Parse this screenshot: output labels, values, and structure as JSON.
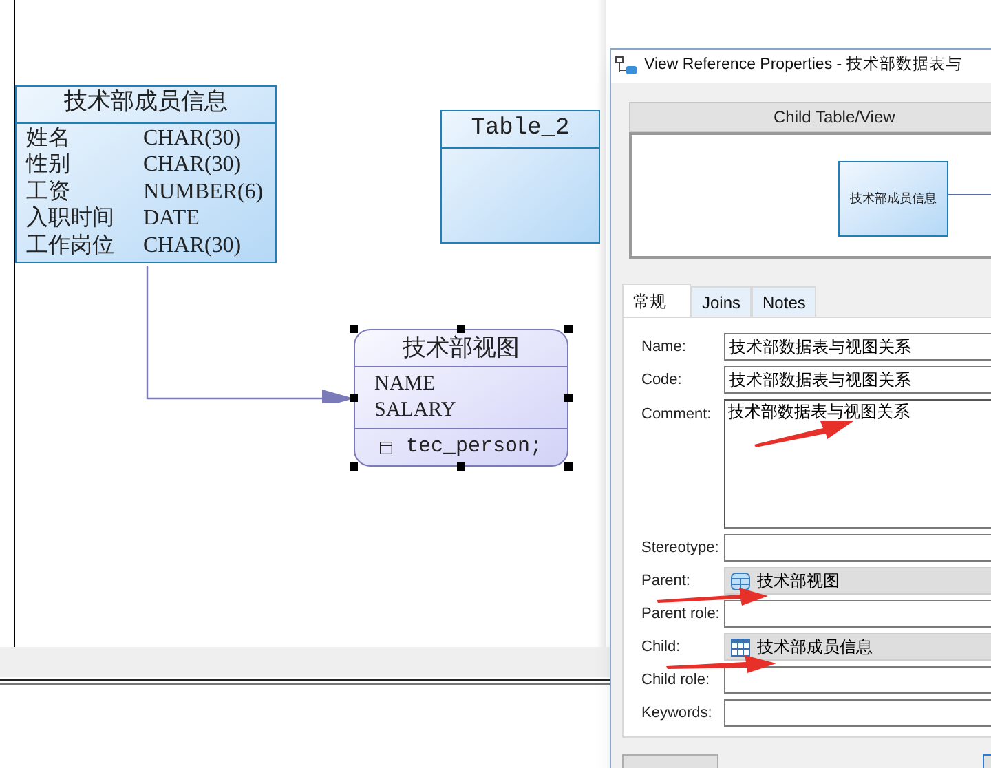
{
  "canvas": {
    "entities": [
      {
        "kind": "table",
        "title": "技术部成员信息",
        "selected": false,
        "columns": [
          {
            "name": "姓名",
            "type": "CHAR(30)"
          },
          {
            "name": "性别",
            "type": "CHAR(30)"
          },
          {
            "name": "工资",
            "type": "NUMBER(6)"
          },
          {
            "name": "入职时间",
            "type": "DATE"
          },
          {
            "name": "工作岗位",
            "type": "CHAR(30)"
          }
        ]
      },
      {
        "kind": "table",
        "title": "Table_2",
        "selected": false
      },
      {
        "kind": "view",
        "title": "技术部视图",
        "selected": true,
        "columns": [
          {
            "name": "NAME"
          },
          {
            "name": "SALARY"
          }
        ],
        "query": "tec_person;"
      }
    ]
  },
  "dialog": {
    "title": "View Reference Properties - 技术部数据表与",
    "preview": {
      "header": "Child Table/View",
      "node": "技术部成员信息"
    },
    "tabs": [
      {
        "label": "常规",
        "selected": true
      },
      {
        "label": "Joins",
        "selected": false
      },
      {
        "label": "Notes",
        "selected": false
      }
    ],
    "fields": [
      {
        "label": "Name:",
        "kind": "text",
        "value": "技术部数据表与视图关系"
      },
      {
        "label": "Code:",
        "kind": "text",
        "value": "技术部数据表与视图关系"
      },
      {
        "label": "Comment:",
        "kind": "textarea",
        "value": "技术部数据表与视图关系"
      },
      {
        "label": "Stereotype:",
        "kind": "text"
      },
      {
        "label": "Parent:",
        "kind": "view",
        "value": "技术部视图"
      },
      {
        "label": "Parent role:",
        "kind": "text"
      },
      {
        "label": "Child:",
        "kind": "table",
        "value": "技术部成员信息"
      },
      {
        "label": "Child role:",
        "kind": "text"
      },
      {
        "label": "Keywords:",
        "kind": "text"
      }
    ]
  }
}
